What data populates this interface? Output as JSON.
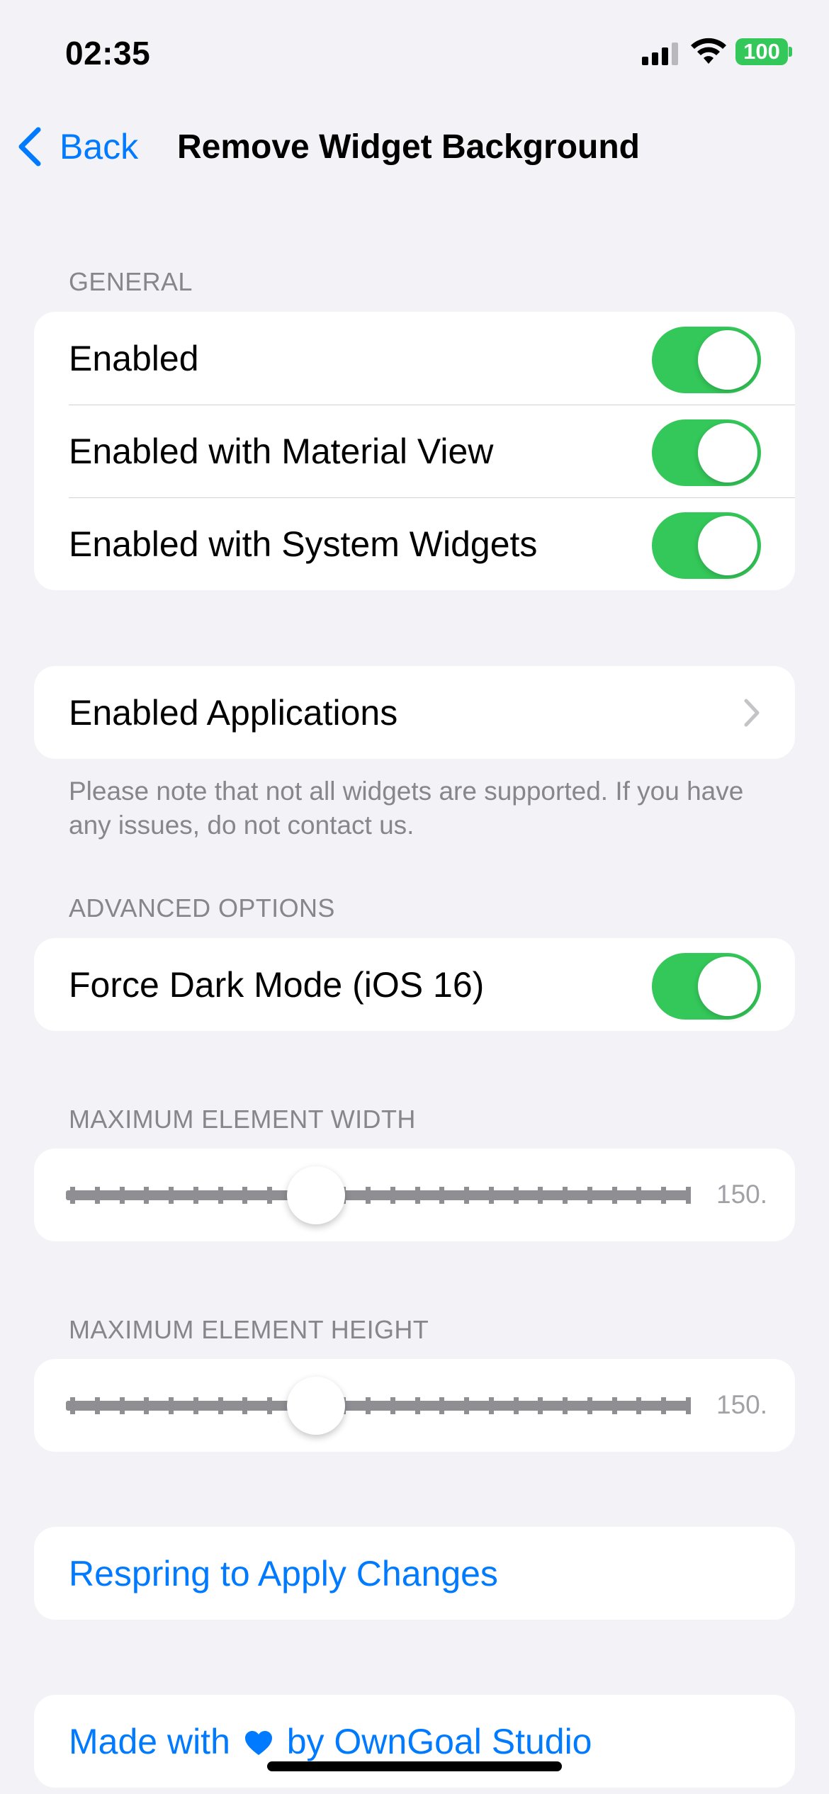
{
  "status_bar": {
    "time": "02:35",
    "battery": "100",
    "signal_bars_active": 3,
    "signal_bars_total": 4
  },
  "nav": {
    "back_label": "Back",
    "title": "Remove Widget Background"
  },
  "general": {
    "header": "GENERAL",
    "rows": [
      {
        "label": "Enabled",
        "on": true
      },
      {
        "label": "Enabled with Material View",
        "on": true
      },
      {
        "label": "Enabled with System Widgets",
        "on": true
      }
    ]
  },
  "applications": {
    "label": "Enabled Applications",
    "footnote": "Please note that not all widgets are supported. If you have any issues, do not contact us."
  },
  "advanced": {
    "header": "ADVANCED OPTIONS",
    "force_dark_label": "Force Dark Mode (iOS 16)",
    "force_dark_on": true
  },
  "max_width": {
    "header": "MAXIMUM ELEMENT WIDTH",
    "value_text": "150.",
    "value_fraction": 0.4
  },
  "max_height": {
    "header": "MAXIMUM ELEMENT HEIGHT",
    "value_text": "150.",
    "value_fraction": 0.4
  },
  "respring_label": "Respring to Apply Changes",
  "credit": {
    "prefix": "Made with",
    "suffix": "by OwnGoal Studio"
  },
  "colors": {
    "accent": "#007aff",
    "toggle_on": "#34c759",
    "background": "#f2f2f7",
    "secondary_text": "#86868b"
  },
  "icons": {
    "back": "chevron-left-icon",
    "disclosure": "chevron-right-icon",
    "credit": "heart-icon"
  }
}
